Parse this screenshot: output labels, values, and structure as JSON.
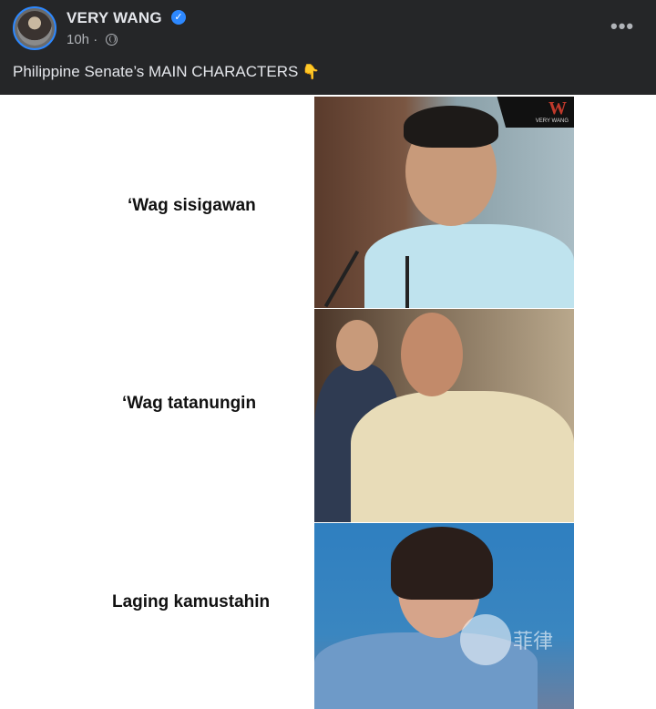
{
  "post": {
    "author": "VERY WANG",
    "time": "10h",
    "separator": "·",
    "caption": "Philippine Senate’s MAIN CHARACTERS",
    "caption_emoji": "👇",
    "more": "•••",
    "verified_mark": "✓"
  },
  "meme": {
    "rows": [
      {
        "text": "‘Wag sisigawan"
      },
      {
        "text": "‘Wag tatanungin"
      },
      {
        "text": "Laging kamustahin"
      }
    ],
    "logo": {
      "mark": "W",
      "sub": "VERY WANG"
    },
    "watermark_text": "菲律"
  },
  "colors": {
    "header_bg": "#252628",
    "accent": "#2d88ff"
  },
  "icons": {
    "verified": "verified-badge-icon",
    "privacy": "globe-icon",
    "menu": "more-options-icon"
  }
}
